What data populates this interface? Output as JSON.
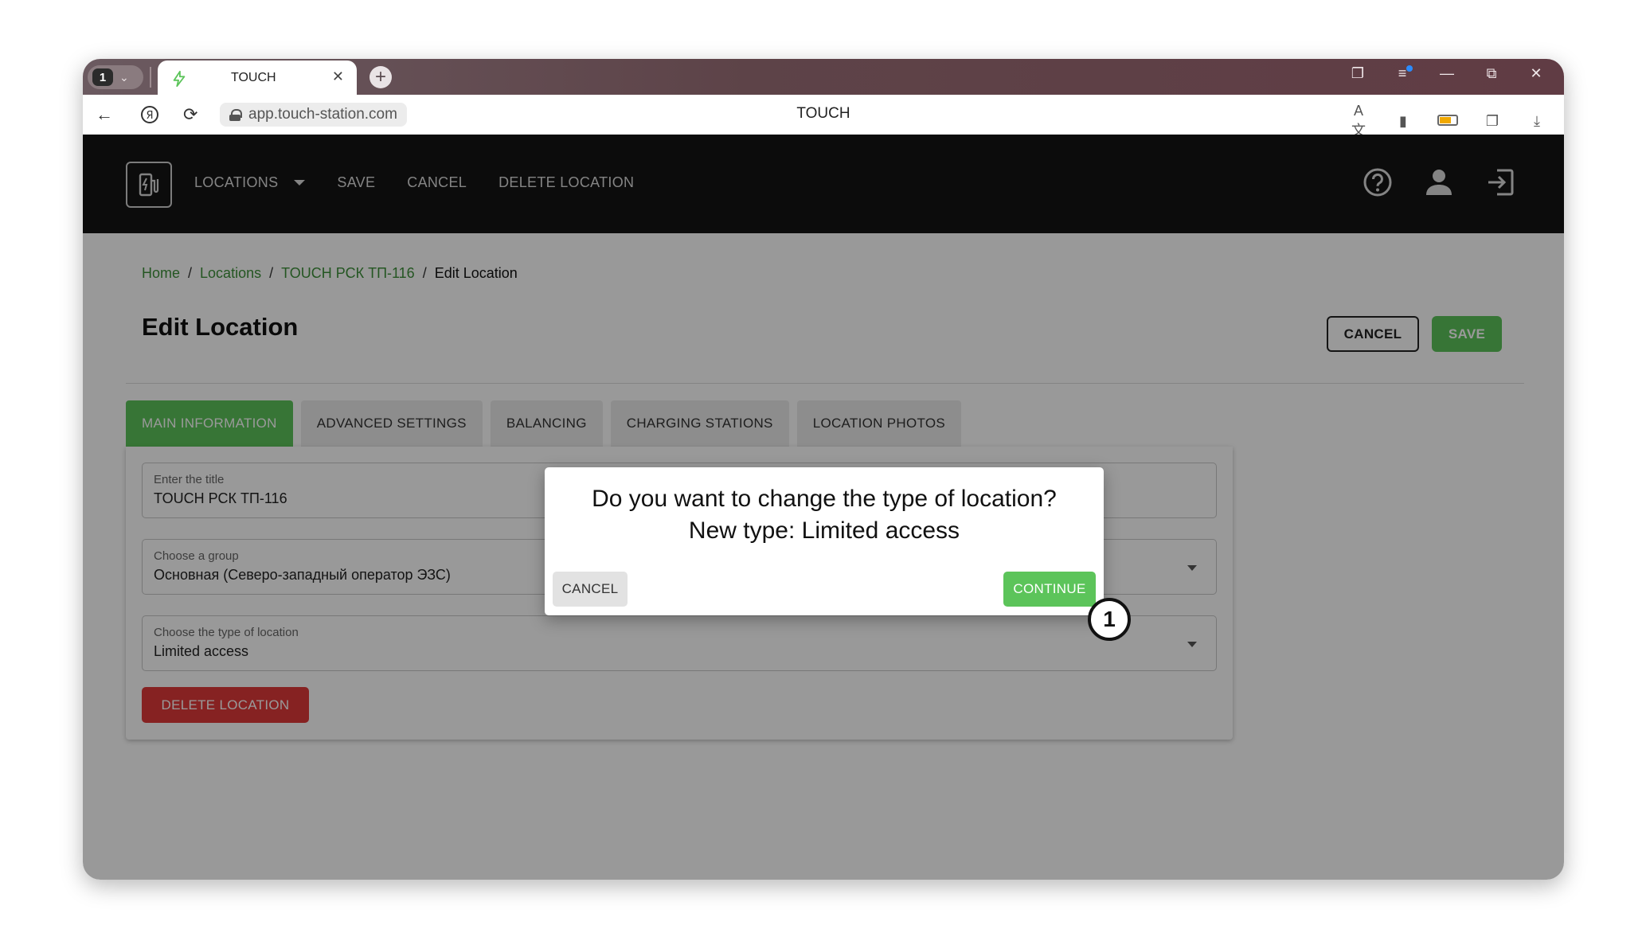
{
  "browser": {
    "tab_count": "1",
    "tab_title": "TOUCH",
    "url": "app.touch-station.com",
    "page_title": "TOUCH"
  },
  "appbar": {
    "nav": [
      {
        "label": "LOCATIONS"
      },
      {
        "label": "SAVE"
      },
      {
        "label": "CANCEL"
      },
      {
        "label": "DELETE LOCATION"
      }
    ]
  },
  "breadcrumb": {
    "home": "Home",
    "locations": "Locations",
    "location": "TOUCH РСК ТП-116",
    "current": "Edit Location",
    "separator": "/"
  },
  "header": {
    "title": "Edit Location",
    "cancel_label": "CANCEL",
    "save_label": "SAVE"
  },
  "tabs": [
    {
      "label": "MAIN INFORMATION"
    },
    {
      "label": "ADVANCED SETTINGS"
    },
    {
      "label": "BALANCING"
    },
    {
      "label": "CHARGING STATIONS"
    },
    {
      "label": "LOCATION PHOTOS"
    }
  ],
  "form": {
    "title_field": {
      "label": "Enter the title",
      "value": "TOUCH РСК ТП-116"
    },
    "group_field": {
      "label": "Choose a group",
      "value": "Основная (Северо-западный оператор ЭЗС)"
    },
    "type_field": {
      "label": "Choose the type of location",
      "value": "Limited access"
    },
    "delete_label": "DELETE LOCATION"
  },
  "dialog": {
    "message": "Do you want to change the type of location? New type: Limited access",
    "cancel_label": "CANCEL",
    "continue_label": "CONTINUE"
  },
  "annotation": {
    "step": "1"
  },
  "colors": {
    "accent_green": "#5cc45a",
    "link_green": "#3d8f3a",
    "danger_red": "#e03a3a",
    "appbar_bg": "#141414"
  }
}
